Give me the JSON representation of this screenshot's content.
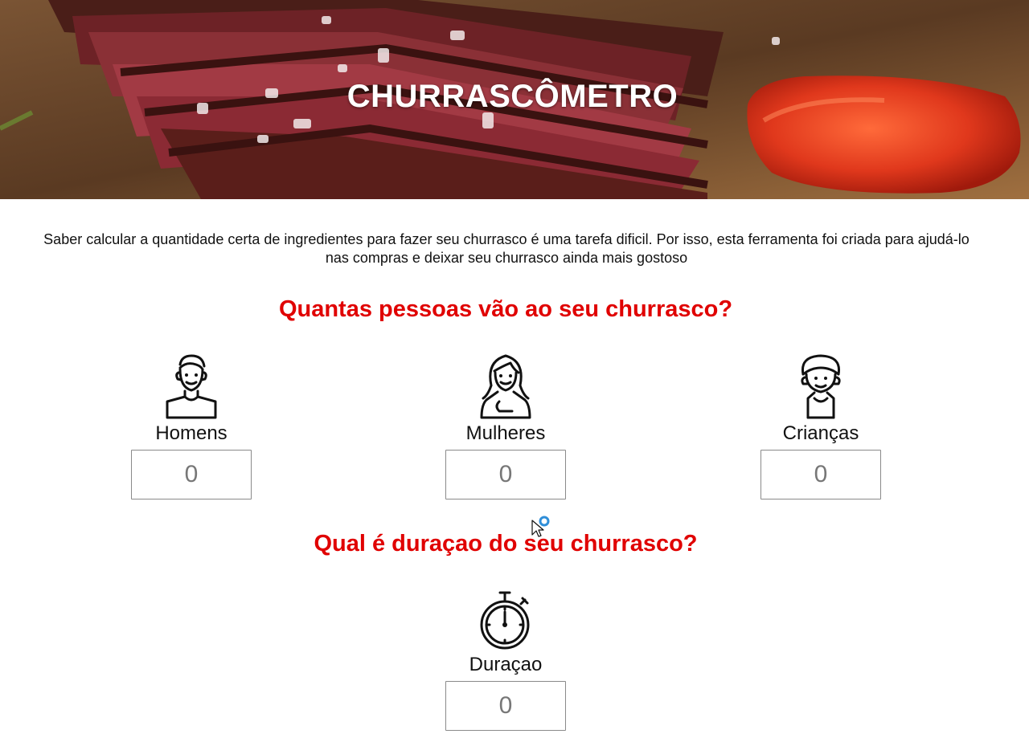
{
  "header": {
    "title": "CHURRASCÔMETRO"
  },
  "intro": {
    "text": "Saber calcular a quantidade certa de ingredientes para fazer seu churrasco é uma tarefa dificil. Por isso, esta ferramenta foi criada para ajudá-lo nas compras e deixar seu churrasco ainda mais gostoso"
  },
  "people_section": {
    "title": "Quantas pessoas vão ao seu churrasco?",
    "groups": [
      {
        "label": "Homens",
        "icon": "man-icon",
        "placeholder": "0"
      },
      {
        "label": "Mulheres",
        "icon": "woman-icon",
        "placeholder": "0"
      },
      {
        "label": "Crianças",
        "icon": "child-icon",
        "placeholder": "0"
      }
    ]
  },
  "duration_section": {
    "title": "Qual é duraçao do seu churrasco?",
    "label": "Duraçao",
    "icon": "stopwatch-icon",
    "placeholder": "0"
  },
  "colors": {
    "accent": "#e00000",
    "title_text": "#ffffff",
    "body_text": "#111111"
  }
}
